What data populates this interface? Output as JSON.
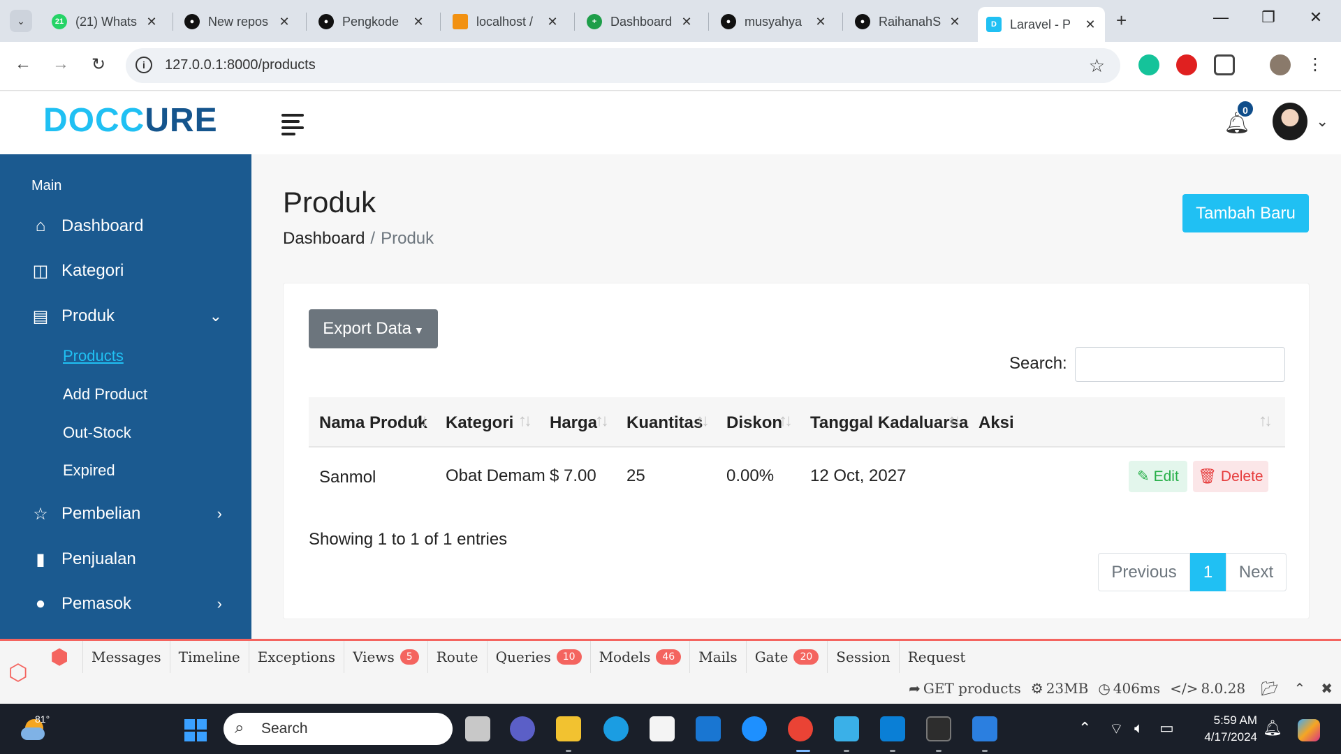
{
  "browser": {
    "tabs": [
      {
        "title": "(21) Whats",
        "icon": "whatsapp-icon",
        "badge": "21"
      },
      {
        "title": "New repos",
        "icon": "github-icon"
      },
      {
        "title": "Pengkode",
        "icon": "github-icon"
      },
      {
        "title": "localhost /",
        "icon": "phpmyadmin-icon"
      },
      {
        "title": "Dashboard",
        "icon": "medical-cross-icon"
      },
      {
        "title": "musyahya",
        "icon": "github-icon"
      },
      {
        "title": "RaihanahS",
        "icon": "github-icon"
      },
      {
        "title": "Laravel - P",
        "icon": "doccure-d-icon",
        "active": true
      }
    ],
    "url": "127.0.0.1:8000/products"
  },
  "header": {
    "logo_main": "DOCC",
    "logo_accent": "URE",
    "notification_count": "0"
  },
  "sidebar": {
    "section_title": "Main",
    "items": [
      {
        "label": "Dashboard",
        "icon": "home-icon"
      },
      {
        "label": "Kategori",
        "icon": "layout-icon"
      },
      {
        "label": "Produk",
        "icon": "document-icon"
      },
      {
        "label": "Pembelian",
        "icon": "star-icon"
      },
      {
        "label": "Penjualan",
        "icon": "bar-chart-icon"
      },
      {
        "label": "Pemasok",
        "icon": "user-icon"
      }
    ],
    "produk_submenu": [
      "Products",
      "Add Product",
      "Out-Stock",
      "Expired"
    ]
  },
  "page": {
    "title": "Produk",
    "breadcrumb": {
      "home": "Dashboard",
      "separator": "/",
      "current": "Produk"
    },
    "add_button": "Tambah Baru"
  },
  "table": {
    "export_button": "Export Data",
    "search_label": "Search:",
    "search_value": "",
    "columns": [
      "Nama Produk",
      "Kategori",
      "Harga",
      "Kuantitas",
      "Diskon",
      "Tanggal Kadaluarsa",
      "Aksi"
    ],
    "rows": [
      {
        "name": "Sanmol",
        "category": "Obat Demam",
        "price": "$ 7.00",
        "qty": "25",
        "discount": "0.00%",
        "expiry": "12 Oct, 2027"
      }
    ],
    "edit_label": "Edit",
    "delete_label": "Delete",
    "info": "Showing 1 to 1 of 1 entries",
    "pagination": {
      "prev": "Previous",
      "page": "1",
      "next": "Next"
    }
  },
  "debugbar": {
    "tabs": [
      {
        "label": "Messages"
      },
      {
        "label": "Timeline"
      },
      {
        "label": "Exceptions"
      },
      {
        "label": "Views",
        "badge": "5"
      },
      {
        "label": "Route"
      },
      {
        "label": "Queries",
        "badge": "10"
      },
      {
        "label": "Models",
        "badge": "46"
      },
      {
        "label": "Mails"
      },
      {
        "label": "Gate",
        "badge": "20"
      },
      {
        "label": "Session"
      },
      {
        "label": "Request"
      }
    ],
    "request": "GET products",
    "memory": "23MB",
    "time": "406ms",
    "php": "8.0.28"
  },
  "taskbar": {
    "temperature": "81°",
    "search_placeholder": "Search",
    "time": "5:59 AM",
    "date": "4/17/2024"
  },
  "colors": {
    "sidebar": "#1b5a90",
    "accent": "#20c0f3",
    "debug_accent": "#f4645f"
  }
}
